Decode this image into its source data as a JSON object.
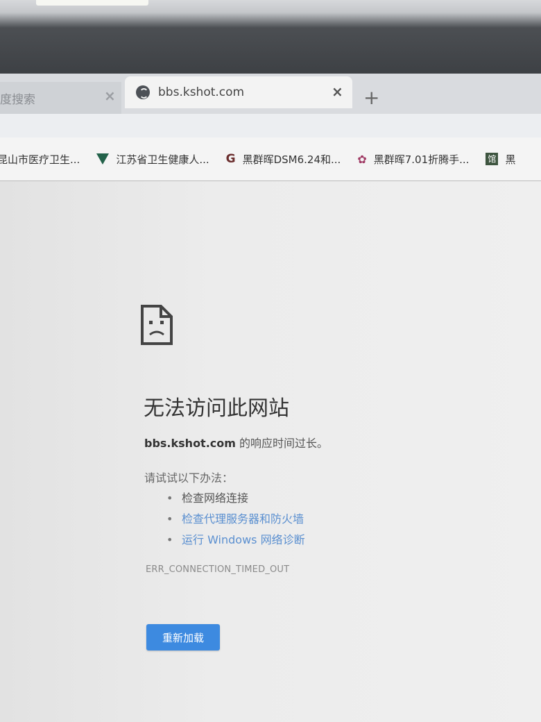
{
  "browser": {
    "tabs": [
      {
        "label": "度搜索",
        "active": false
      },
      {
        "label": "bbs.kshot.com",
        "active": true
      }
    ],
    "close_glyph": "×",
    "new_tab_glyph": "+",
    "bookmarks": [
      {
        "label": "昆山市医疗卫生...",
        "icon": "none"
      },
      {
        "label": "江苏省卫生健康人...",
        "icon": "green-v-icon"
      },
      {
        "label": "黑群晖DSM6.24和...",
        "icon": "g-logo-icon"
      },
      {
        "label": "黑群晖7.01折腾手...",
        "icon": "flower-icon"
      },
      {
        "label": "黑",
        "icon": "green-box-icon"
      }
    ],
    "bookmark_box_glyph": "馆"
  },
  "error_page": {
    "title": "无法访问此网站",
    "host": "bbs.kshot.com",
    "subtitle_suffix": " 的响应时间过长。",
    "try_label": "请试试以下办法：",
    "suggestions": [
      {
        "text": "检查网络连接",
        "link": false
      },
      {
        "text": "检查代理服务器和防火墙",
        "link": true
      },
      {
        "text": "运行 Windows 网络诊断",
        "link": true
      }
    ],
    "error_code": "ERR_CONNECTION_TIMED_OUT",
    "reload_label": "重新加载"
  },
  "colors": {
    "link": "#5a8fd0",
    "button": "#3d8ae0"
  }
}
